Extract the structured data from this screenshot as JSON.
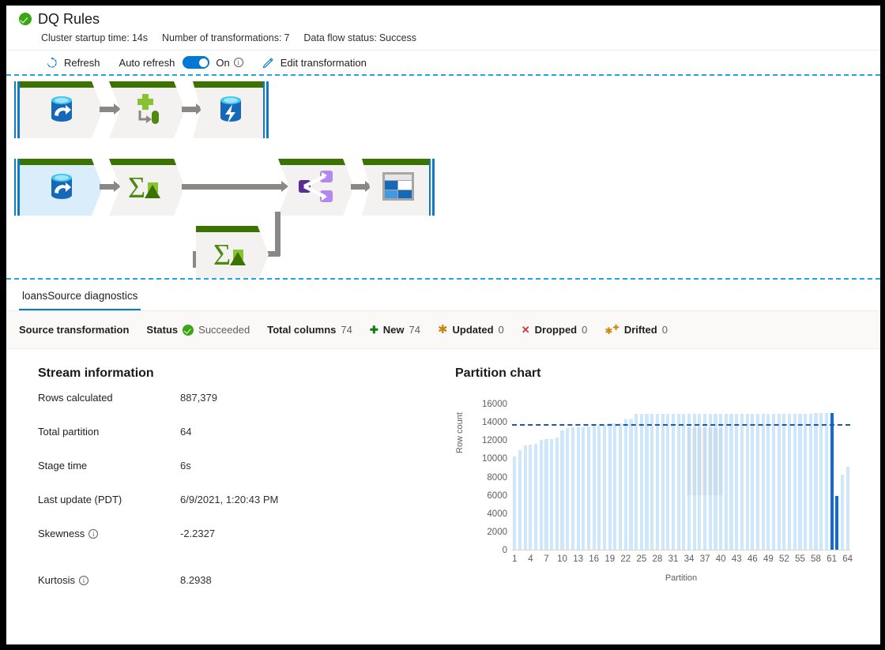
{
  "header": {
    "status_icon": "success-check-icon",
    "title": "DQ Rules",
    "meta": [
      {
        "key": "Cluster startup time:",
        "value": "14s"
      },
      {
        "key": "Number of transformations:",
        "value": "7"
      },
      {
        "key": "Data flow status:",
        "value": "Success"
      }
    ]
  },
  "toolbar": {
    "refresh_label": "Refresh",
    "auto_refresh_label": "Auto refresh",
    "toggle_state": "On",
    "edit_label": "Edit transformation",
    "accent": "#0078d4"
  },
  "canvas": {
    "nodes": [
      {
        "name": "source-node-1",
        "icon": "database-source-icon"
      },
      {
        "name": "derived-column-node",
        "icon": "derived-column-icon"
      },
      {
        "name": "sink-node-1",
        "icon": "database-sink-icon"
      },
      {
        "name": "source-node-2",
        "icon": "database-source-icon",
        "selected": true
      },
      {
        "name": "aggregate-node-1",
        "icon": "aggregate-sigma-icon"
      },
      {
        "name": "conditional-split-node",
        "icon": "conditional-split-icon"
      },
      {
        "name": "sink-node-2",
        "icon": "window-sink-icon"
      },
      {
        "name": "aggregate-node-2",
        "icon": "aggregate-sigma-icon"
      }
    ]
  },
  "tab": {
    "label": "loansSource diagnostics"
  },
  "stats": [
    {
      "label": "Source transformation",
      "value": "",
      "icon": ""
    },
    {
      "label": "Status",
      "value": "Succeeded",
      "icon": "success-check-icon"
    },
    {
      "label": "Total columns",
      "value": "74",
      "icon": ""
    },
    {
      "label": "New",
      "value": "74",
      "icon": "plus-icon"
    },
    {
      "label": "Updated",
      "value": "0",
      "icon": "asterisk-icon"
    },
    {
      "label": "Dropped",
      "value": "0",
      "icon": "x-icon"
    },
    {
      "label": "Drifted",
      "value": "0",
      "icon": "drift-icon"
    }
  ],
  "stream_information": {
    "title": "Stream information",
    "rows": [
      {
        "key": "Rows calculated",
        "value": "887,379",
        "info": false
      },
      {
        "key": "Total partition",
        "value": "64",
        "info": false
      },
      {
        "key": "Stage time",
        "value": "6s",
        "info": false
      },
      {
        "key": "Last update (PDT)",
        "value": "6/9/2021, 1:20:43 PM",
        "info": false
      },
      {
        "key": "Skewness",
        "value": "-2.2327",
        "info": true
      },
      {
        "key": "Kurtosis",
        "value": "8.2938",
        "info": true
      }
    ]
  },
  "chart_data": {
    "type": "bar",
    "title": "Partition chart",
    "xlabel": "Partition",
    "ylabel": "Row count",
    "ylim": [
      0,
      16000
    ],
    "ytick_values": [
      0,
      2000,
      4000,
      6000,
      8000,
      10000,
      12000,
      14000,
      16000
    ],
    "xtick_values": [
      1,
      4,
      7,
      10,
      13,
      16,
      19,
      22,
      25,
      28,
      31,
      34,
      37,
      40,
      43,
      46,
      49,
      52,
      55,
      58,
      61,
      64
    ],
    "grid": false,
    "legend": "none",
    "average_line": 13850,
    "bar_color": "#cfe7fb",
    "highlight_color": "#0f6cd4",
    "highlight_indices": [
      61,
      62
    ],
    "categories": [
      1,
      2,
      3,
      4,
      5,
      6,
      7,
      8,
      9,
      10,
      11,
      12,
      13,
      14,
      15,
      16,
      17,
      18,
      19,
      20,
      21,
      22,
      23,
      24,
      25,
      26,
      27,
      28,
      29,
      30,
      31,
      32,
      33,
      34,
      35,
      36,
      37,
      38,
      39,
      40,
      41,
      42,
      43,
      44,
      45,
      46,
      47,
      48,
      49,
      50,
      51,
      52,
      53,
      54,
      55,
      56,
      57,
      58,
      59,
      60,
      61,
      62,
      63,
      64
    ],
    "values": [
      10200,
      10900,
      11400,
      11500,
      11600,
      12050,
      12100,
      12150,
      12250,
      13100,
      13350,
      13400,
      13400,
      13400,
      13450,
      13550,
      13600,
      13650,
      13800,
      13800,
      13850,
      14250,
      14300,
      14900,
      14900,
      14900,
      14900,
      14900,
      14900,
      14900,
      14900,
      14900,
      14900,
      14900,
      14900,
      14900,
      14900,
      14900,
      14900,
      14900,
      14900,
      14900,
      14900,
      14900,
      14900,
      14900,
      14900,
      14900,
      14900,
      14900,
      14900,
      14900,
      14900,
      14900,
      14900,
      14900,
      14900,
      14950,
      14950,
      14950,
      15000,
      5900,
      8200,
      9100
    ]
  }
}
